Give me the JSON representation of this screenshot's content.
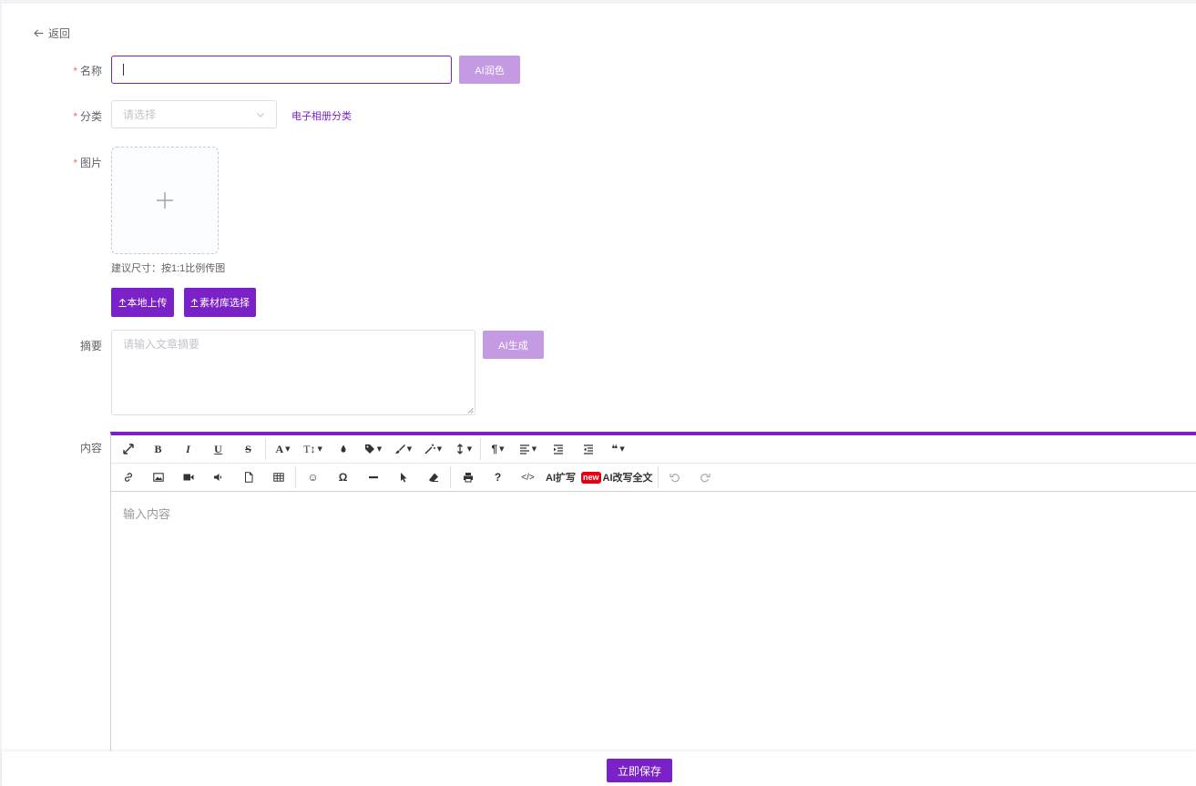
{
  "back": {
    "label": "返回"
  },
  "form": {
    "name": {
      "label": "名称",
      "value": "",
      "ai_button": "AI润色"
    },
    "category": {
      "label": "分类",
      "placeholder": "请选择",
      "link": "电子相册分类"
    },
    "image": {
      "label": "图片",
      "hint": "建议尺寸：按1:1比例传图",
      "local_upload": "本地上传",
      "library_select": "素材库选择"
    },
    "summary": {
      "label": "摘要",
      "placeholder": "请输入文章摘要",
      "ai_button": "AI生成"
    },
    "content": {
      "label": "内容",
      "placeholder": "输入内容",
      "toolbar": {
        "ai_expand": "AI扩写",
        "new_badge": "new",
        "ai_rewrite": "AI改写全文"
      }
    }
  },
  "footer": {
    "save_label": "立即保存"
  },
  "colors": {
    "primary": "#7a22c7",
    "primary_light": "#c49be3",
    "required": "#f56c6c",
    "new_badge": "#e60012"
  }
}
